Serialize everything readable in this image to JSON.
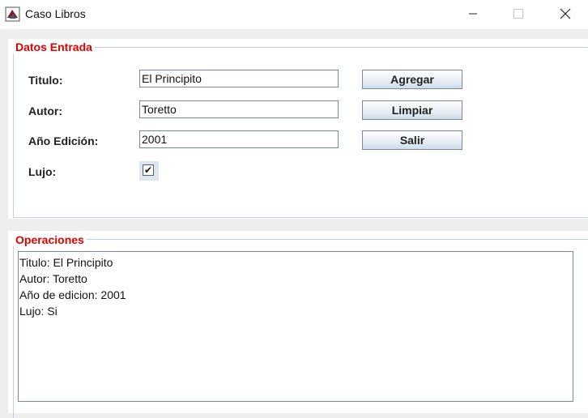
{
  "window": {
    "title": "Caso Libros",
    "icons": {
      "app": "java-app-icon",
      "minimize": "minimize-icon",
      "maximize": "maximize-icon",
      "close": "close-icon"
    }
  },
  "entrada": {
    "legend": "Datos Entrada",
    "titulo_label": "Titulo:",
    "titulo_value": "El Principito",
    "autor_label": "Autor:",
    "autor_value": "Toretto",
    "anio_label": "Año Edición:",
    "anio_value": "2001",
    "lujo_label": "Lujo:",
    "lujo_checked": true,
    "lujo_mark": "✔"
  },
  "buttons": {
    "agregar": "Agregar",
    "limpiar": "Limpiar",
    "salir": "Salir"
  },
  "operaciones": {
    "legend": "Operaciones",
    "lines": [
      "Titulo: El Principito",
      "Autor: Toretto",
      "Año de edicion: 2001",
      "Lujo: Si"
    ]
  },
  "colors": {
    "legend": "#e00000",
    "panel_border": "#c3d0dc",
    "window_bg": "#eeeeee"
  }
}
